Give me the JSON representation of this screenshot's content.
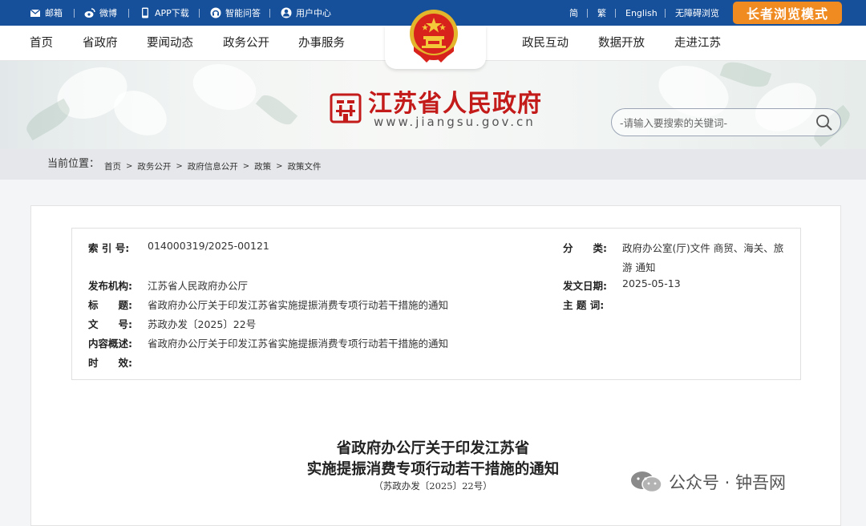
{
  "topbar": {
    "left_items": [
      {
        "label": "邮箱",
        "icon": "mail-icon"
      },
      {
        "label": "微博",
        "icon": "weibo-icon"
      },
      {
        "label": "APP下载",
        "icon": "phone-icon"
      },
      {
        "label": "智能问答",
        "icon": "headset-icon"
      },
      {
        "label": "用户中心",
        "icon": "user-icon"
      }
    ],
    "right_items": [
      "简",
      "繁",
      "English",
      "无障碍浏览"
    ],
    "elder_mode": "长者浏览模式"
  },
  "nav": {
    "left": [
      "首页",
      "省政府",
      "要闻动态",
      "政务公开",
      "办事服务"
    ],
    "right": [
      "政民互动",
      "数据开放",
      "走进江苏"
    ]
  },
  "banner": {
    "site_name": "江苏省人民政府",
    "site_url": "www.jiangsu.gov.cn",
    "search_placeholder": "-请输入要搜索的关键词-"
  },
  "breadcrumb": {
    "label": "当前位置：",
    "items": [
      "首页",
      "政务公开",
      "政府信息公开",
      "政策",
      "政策文件"
    ]
  },
  "info": {
    "index_label": "索 引 号:",
    "index_value": "014000319/2025-00121",
    "category_label": "分　　类:",
    "category_value_1": "政府办公室(厅)文件 商贸、海关、旅",
    "category_value_2": "游 通知",
    "publisher_label": "发布机构:",
    "publisher_value": "江苏省人民政府办公厅",
    "date_label": "发文日期:",
    "date_value": "2025-05-13",
    "title_label": "标　　题:",
    "title_value": "省政府办公厅关于印发江苏省实施提振消费专项行动若干措施的通知",
    "subject_label": "主 题 词:",
    "docno_label": "文　　号:",
    "docno_value": "苏政办发〔2025〕22号",
    "summary_label": "内容概述:",
    "summary_value": "省政府办公厅关于印发江苏省实施提振消费专项行动若干措施的通知",
    "validity_label": "时　　效:"
  },
  "document": {
    "title_line1": "省政府办公厅关于印发江苏省",
    "title_line2": "实施提振消费专项行动若干措施的通知",
    "doc_number": "（苏政办发〔2025〕22号）"
  },
  "watermark": {
    "text": "公众号 · 钟吾网",
    "icon": "wechat-icon"
  },
  "colors": {
    "topbar": "#16509b",
    "elder_button": "#f08b22",
    "site_name": "#c31a1a"
  }
}
